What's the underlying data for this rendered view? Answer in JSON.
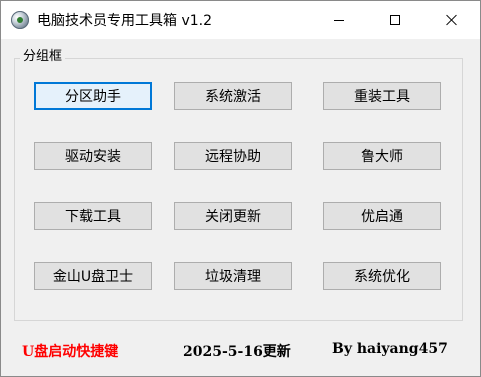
{
  "window": {
    "title": "电脑技术员专用工具箱 v1.2",
    "icon": "globe-disc-icon"
  },
  "titlebar_controls": {
    "minimize_icon": "minimize-icon",
    "maximize_icon": "maximize-icon",
    "close_icon": "close-icon"
  },
  "group": {
    "label": "分组框"
  },
  "buttons": [
    {
      "label": "分区助手",
      "focused": true
    },
    {
      "label": "系统激活"
    },
    {
      "label": "重装工具"
    },
    {
      "label": "驱动安装"
    },
    {
      "label": "远程协助"
    },
    {
      "label": "鲁大师"
    },
    {
      "label": "下载工具"
    },
    {
      "label": "关闭更新"
    },
    {
      "label": "优启通"
    },
    {
      "label": "金山U盘卫士"
    },
    {
      "label": "垃圾清理"
    },
    {
      "label": "系统优化"
    }
  ],
  "footer": {
    "hotkey_label": "U盘启动快捷键",
    "update_date": "2025-5-16更新",
    "author": "By haiyang457"
  },
  "colors": {
    "focus_accent": "#0078d7",
    "hotkey_text": "#ff0000"
  }
}
